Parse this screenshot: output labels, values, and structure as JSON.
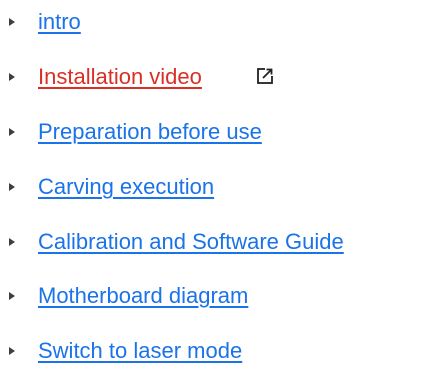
{
  "nav": {
    "items": [
      {
        "label": "intro ",
        "active": false
      },
      {
        "label": "Installation video",
        "active": true,
        "external": true,
        "icon": "external-link-icon"
      },
      {
        "label": "Preparation before use",
        "active": false
      },
      {
        "label": "Carving execution",
        "active": false
      },
      {
        "label": "Calibration and Software Guide",
        "active": false
      },
      {
        "label": "Motherboard diagram",
        "active": false
      },
      {
        "label": "Switch to laser mode",
        "active": false
      }
    ]
  },
  "colors": {
    "link": "#1a73e8",
    "active_link": "#d93025",
    "bullet": "#3c4043",
    "icon": "#202124"
  }
}
